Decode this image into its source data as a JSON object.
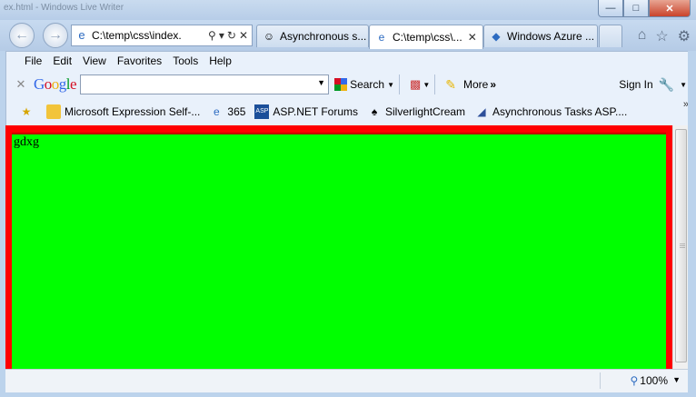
{
  "window": {
    "title": "ex.html - Windows Live Writer",
    "buttons": [
      "minimize",
      "maximize",
      "close"
    ]
  },
  "nav": {
    "back_icon": "back-arrow-icon",
    "forward_icon": "forward-arrow-icon",
    "address": "C:\\temp\\css\\index.",
    "right_icons": [
      "home-icon",
      "star-icon",
      "gear-icon"
    ]
  },
  "tabs": [
    {
      "label": "Asynchronous s...",
      "icon": "person-icon"
    },
    {
      "label": "C:\\temp\\css\\...",
      "icon": "ie-page-icon",
      "active": true
    },
    {
      "label": "Windows Azure ...",
      "icon": "azure-icon"
    }
  ],
  "menu": [
    "File",
    "Edit",
    "View",
    "Favorites",
    "Tools",
    "Help"
  ],
  "google": {
    "logo": "Google",
    "search_value": "",
    "search_label": "Search",
    "more_label": "More",
    "signin_label": "Sign In"
  },
  "favorites": [
    {
      "label": "Microsoft Expression Self-...",
      "icon": "folder-icon"
    },
    {
      "label": "365",
      "icon": "ie-page-icon"
    },
    {
      "label": "ASP.NET Forums",
      "icon": "aspnet-icon"
    },
    {
      "label": "SilverlightCream",
      "icon": "spade-icon"
    },
    {
      "label": "Asynchronous Tasks ASP....",
      "icon": "vs-icon"
    }
  ],
  "page": {
    "text": "gdxg",
    "colors": {
      "outer": "#ff0000",
      "inner": "#00ff00"
    }
  },
  "status": {
    "zoom": "100%"
  }
}
